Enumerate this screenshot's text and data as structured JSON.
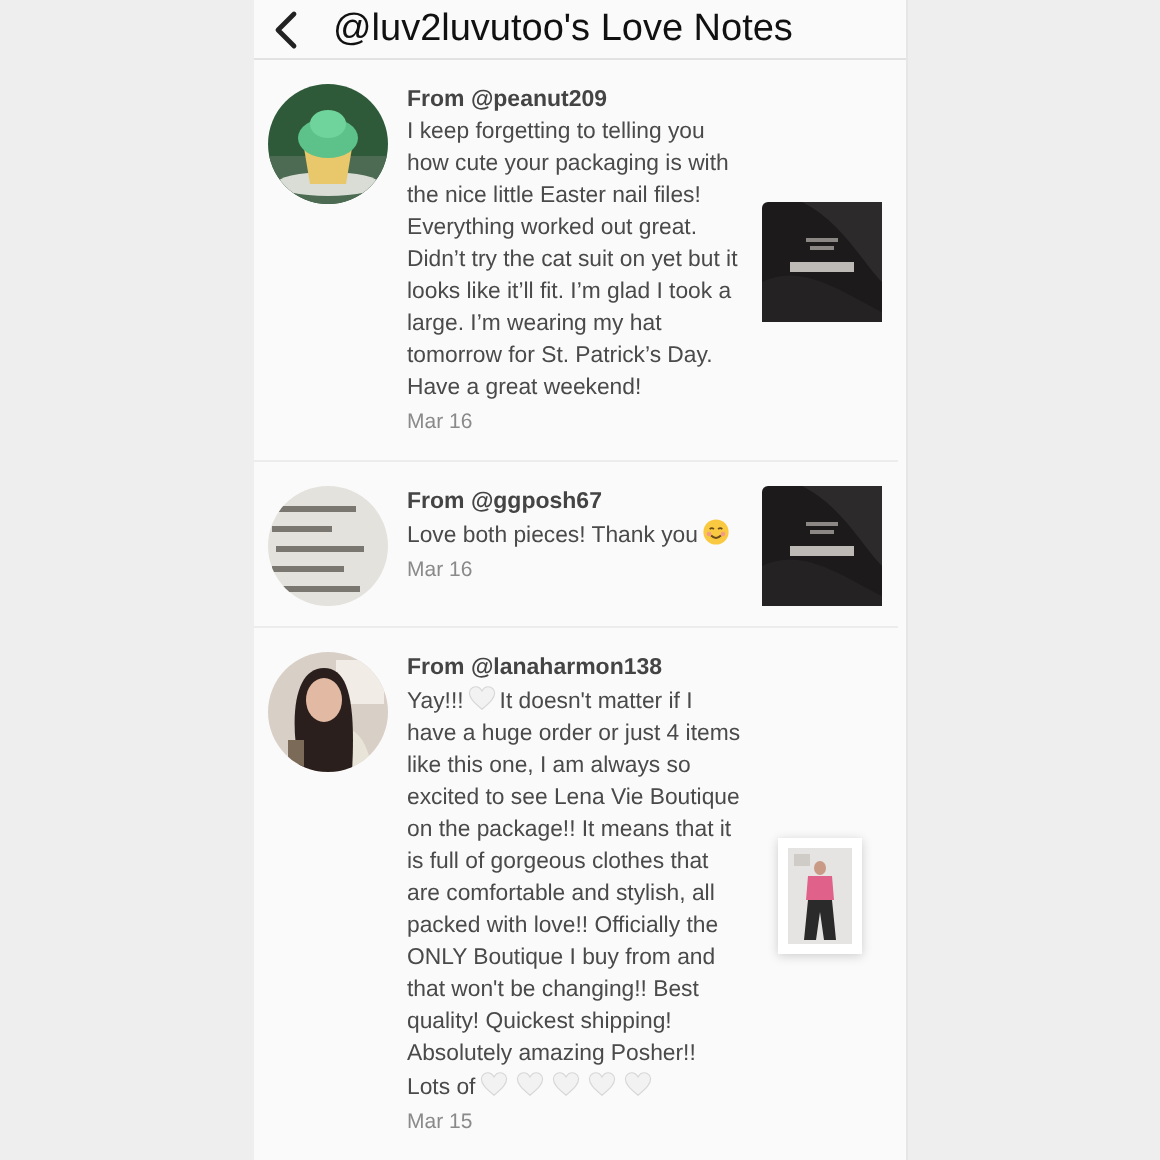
{
  "header": {
    "title": "@luv2luvutoo's Love Notes"
  },
  "notes": [
    {
      "from": "From @peanut209",
      "date": "Mar 16",
      "kind": "cover",
      "message": [
        {
          "kind": "text",
          "text": "I keep forgetting to telling you how cute your packaging is with the nice little Easter nail files! Everything worked out great. Didn’t try the cat suit on yet but it looks like it’ll fit. I’m glad I took a large. I’m wearing my hat tomorrow for St. Patrick’s Day. Have a great weekend!"
        }
      ]
    },
    {
      "from": "From @ggposh67",
      "date": "Mar 16",
      "kind": "cover",
      "message": [
        {
          "kind": "text",
          "text": "Love both pieces! Thank you"
        },
        {
          "kind": "smile"
        }
      ]
    },
    {
      "from": "From @lanaharmon138",
      "date": "Mar 15",
      "kind": "card",
      "message": [
        {
          "kind": "text",
          "text": "Yay!!!"
        },
        {
          "kind": "heart"
        },
        {
          "kind": "text",
          "text": "It doesn't matter if I have a huge order or just 4 items like this one, I am always so excited to see Lena Vie Boutique on the package!! It means that it is full of gorgeous clothes that are comfortable and stylish, all packed with love!! Officially the ONLY Boutique I buy from and that won't be changing!! Best quality! Quickest shipping! Absolutely amazing Posher!! Lots of"
        },
        {
          "kind": "heart"
        },
        {
          "kind": "heart"
        },
        {
          "kind": "heart"
        },
        {
          "kind": "heart"
        },
        {
          "kind": "heart"
        }
      ]
    }
  ]
}
